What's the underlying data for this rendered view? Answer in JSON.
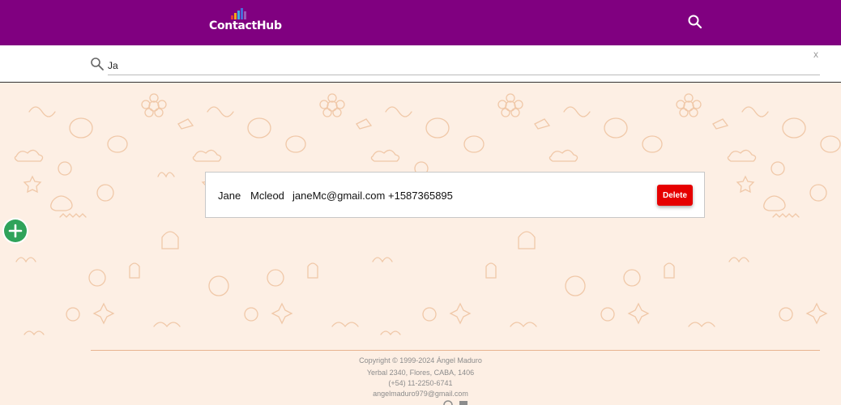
{
  "header": {
    "app_name": "ContactHub",
    "logo_bar_colors": [
      "#e03b3b",
      "#f2a516",
      "#3ab0e2",
      "#4a6bd8",
      "#9b59b6"
    ],
    "search_icon": "search-icon"
  },
  "search": {
    "value": "Ja",
    "icon": "search-icon",
    "close_label": "x"
  },
  "contacts": [
    {
      "first_name": "Jane",
      "last_name": "Mcleod",
      "email": "janeMc@gmail.com",
      "phone": "+1587365895",
      "delete_label": "Delete"
    }
  ],
  "add_button": {
    "label": "+",
    "icon": "plus-icon"
  },
  "footer": {
    "copyright": "Copyright © 1999-2024 Ángel Maduro",
    "address": "Yerbal 2340, Flores, CABA, 1406",
    "phone": "(+54) 11-2250-6741",
    "email": "angelmaduro979@gmail.com",
    "icons": [
      "github-icon",
      "linkedin-icon"
    ]
  },
  "colors": {
    "header_bg": "#800080",
    "page_bg": "#fdefe4",
    "pattern": "#f0c8a8",
    "delete": "#e60000",
    "add": "#2fa35a"
  }
}
